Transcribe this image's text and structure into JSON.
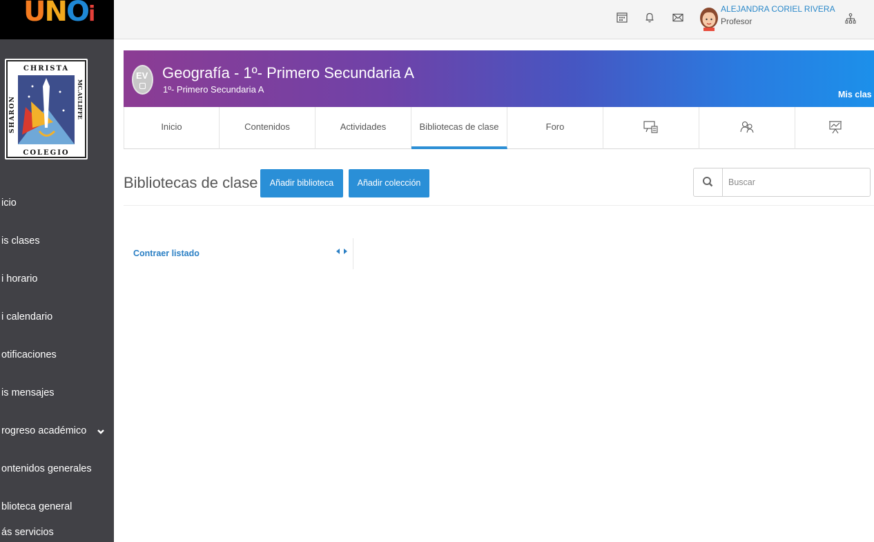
{
  "brand": {
    "logo_text": [
      "U",
      "N",
      "O",
      "i"
    ],
    "logo_colors": [
      "#f47b20",
      "#f2a81d",
      "#1e88d6",
      "#e5403a"
    ],
    "school_logo_lines": [
      "CHRISTA",
      "SHARON",
      "MC.AULIFFE",
      "COLEGIO"
    ]
  },
  "sidebar": {
    "items": [
      {
        "label": "icio"
      },
      {
        "label": "is clases"
      },
      {
        "label": "i horario"
      },
      {
        "label": "i calendario"
      },
      {
        "label": "otificaciones"
      },
      {
        "label": "is mensajes"
      },
      {
        "label": "rogreso académico",
        "expandable": true
      },
      {
        "label": "ontenidos generales"
      },
      {
        "label": "blioteca general"
      },
      {
        "label": "ás servicios"
      }
    ]
  },
  "topbar": {
    "icons": [
      "calendar-icon",
      "bell-icon",
      "mail-icon",
      "org-chart-icon"
    ],
    "user_name": "ALEJANDRA CORIEL RIVERA",
    "user_role": "Profesor"
  },
  "banner": {
    "badge": "EV",
    "title": "Geografía  - 1º- Primero Secundaria A",
    "subtitle": "1º- Primero Secundaria A",
    "link": "Mis clas"
  },
  "tabs": [
    {
      "label": "Inicio"
    },
    {
      "label": "Contenidos"
    },
    {
      "label": "Actividades"
    },
    {
      "label": "Bibliotecas de clase",
      "active": true
    },
    {
      "label": "Foro"
    },
    {
      "icon": "presentation-icon"
    },
    {
      "icon": "people-icon"
    },
    {
      "icon": "chart-board-icon"
    }
  ],
  "page": {
    "title": "Bibliotecas de clase",
    "add_library": "Añadir biblioteca",
    "add_collection": "Añadir colección",
    "search_placeholder": "Buscar",
    "collapse_label": "Contraer listado"
  },
  "colors": {
    "accent": "#2a8fd7",
    "sidebar": "#414146",
    "link": "#2a7fc4"
  }
}
